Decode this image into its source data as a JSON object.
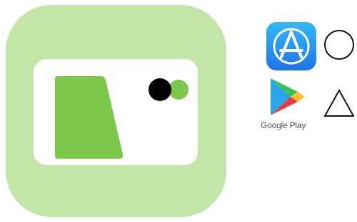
{
  "app_icon": {
    "icon": "card-app-icon",
    "colors": {
      "background": "#c2e6a7",
      "card": "#ffffff",
      "card_slot": "#7dc84a",
      "dot_black": "#000000",
      "dot_green": "#7dc84a"
    }
  },
  "stores": [
    {
      "icon": "app-store-icon",
      "mark_icon": "circle-mark-icon",
      "mark_glyph": "○"
    },
    {
      "icon": "google-play-icon",
      "label": "Google Play",
      "mark_icon": "triangle-mark-icon",
      "mark_glyph": "△"
    }
  ]
}
